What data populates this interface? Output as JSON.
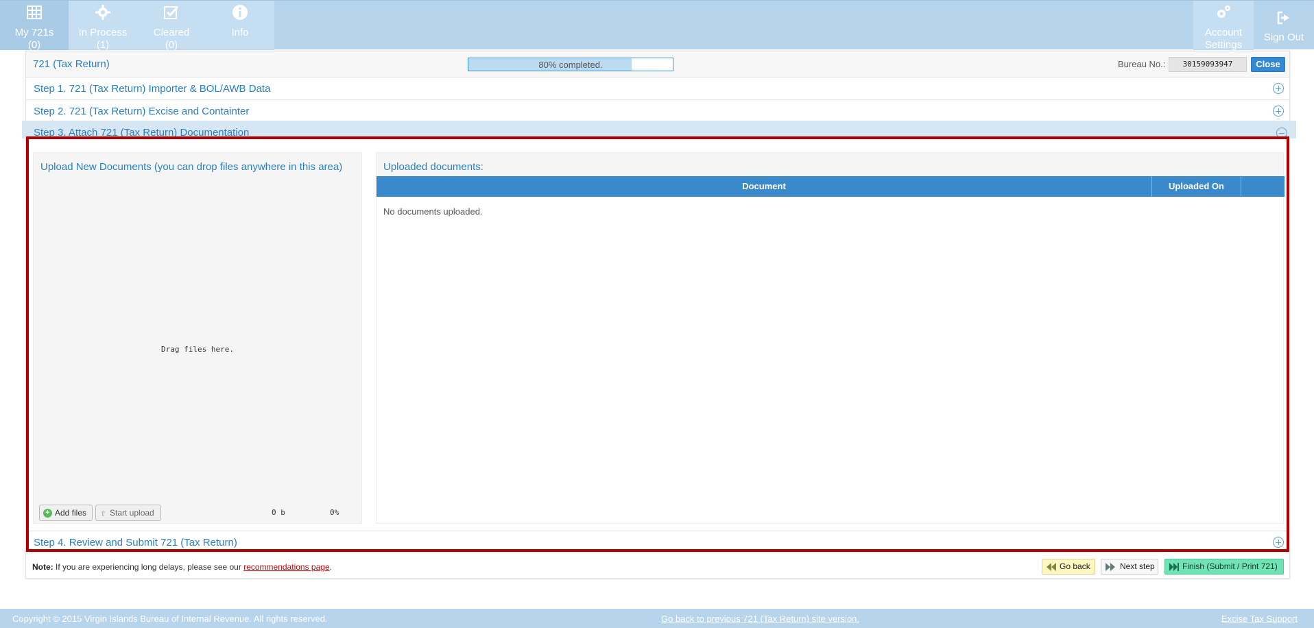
{
  "nav": {
    "items": [
      {
        "label": "My 721s",
        "count": "(0)",
        "icon": "table-icon"
      },
      {
        "label": "In Process",
        "count": "(1)",
        "icon": "gear-icon"
      },
      {
        "label": "Cleared",
        "count": "(0)",
        "icon": "check-square-icon"
      },
      {
        "label": "Info",
        "icon": "info-icon"
      }
    ],
    "account_label_1": "Account",
    "account_label_2": "Settings",
    "signout_label": "Sign Out"
  },
  "header": {
    "title": "721 (Tax Return)",
    "progress_text": "80% completed.",
    "progress_value": 80,
    "bureau_label": "Bureau No.:",
    "bureau_value": "30159093947",
    "close_label": "Close"
  },
  "steps": [
    {
      "label": "Step 1. 721 (Tax Return) Importer & BOL/AWB Data",
      "expanded": false
    },
    {
      "label": "Step 2. 721 (Tax Return) Excise and Containter",
      "expanded": false
    },
    {
      "label": "Step 3. Attach 721 (Tax Return) Documentation",
      "expanded": true
    },
    {
      "label": "Step 4. Review and Submit 721 (Tax Return)",
      "expanded": false
    }
  ],
  "upload": {
    "title": "Upload New Documents (you can drop files anywhere in this area)",
    "drag_text": "Drag files here.",
    "add_label": "Add files",
    "start_label": "Start upload",
    "size": "0 b",
    "percent": "0%"
  },
  "documents": {
    "title": "Uploaded documents:",
    "columns": [
      "Document",
      "Uploaded On"
    ],
    "empty_text": "No documents uploaded."
  },
  "note": {
    "bold": "Note:",
    "text": "If you are experiencing long delays, please see our",
    "link": "recommendations page",
    "end": "."
  },
  "actions": {
    "back": "Go back",
    "next": "Next step",
    "finish": "Finish (Submit / Print 721)"
  },
  "footer": {
    "copyright": "Copyright © 2015 Virgin Islands Bureau of Internal Revenue. All rights reserved.",
    "previous_version": "Go back to previous 721 (Tax Return) site version.",
    "support": "Excise Tax Support"
  },
  "colors": {
    "nav_bg": "#b6d5ec",
    "accent": "#2a7fc2",
    "table_header": "#3a89cb",
    "highlight": "#b00000",
    "finish_btn": "#6fe3b4"
  }
}
